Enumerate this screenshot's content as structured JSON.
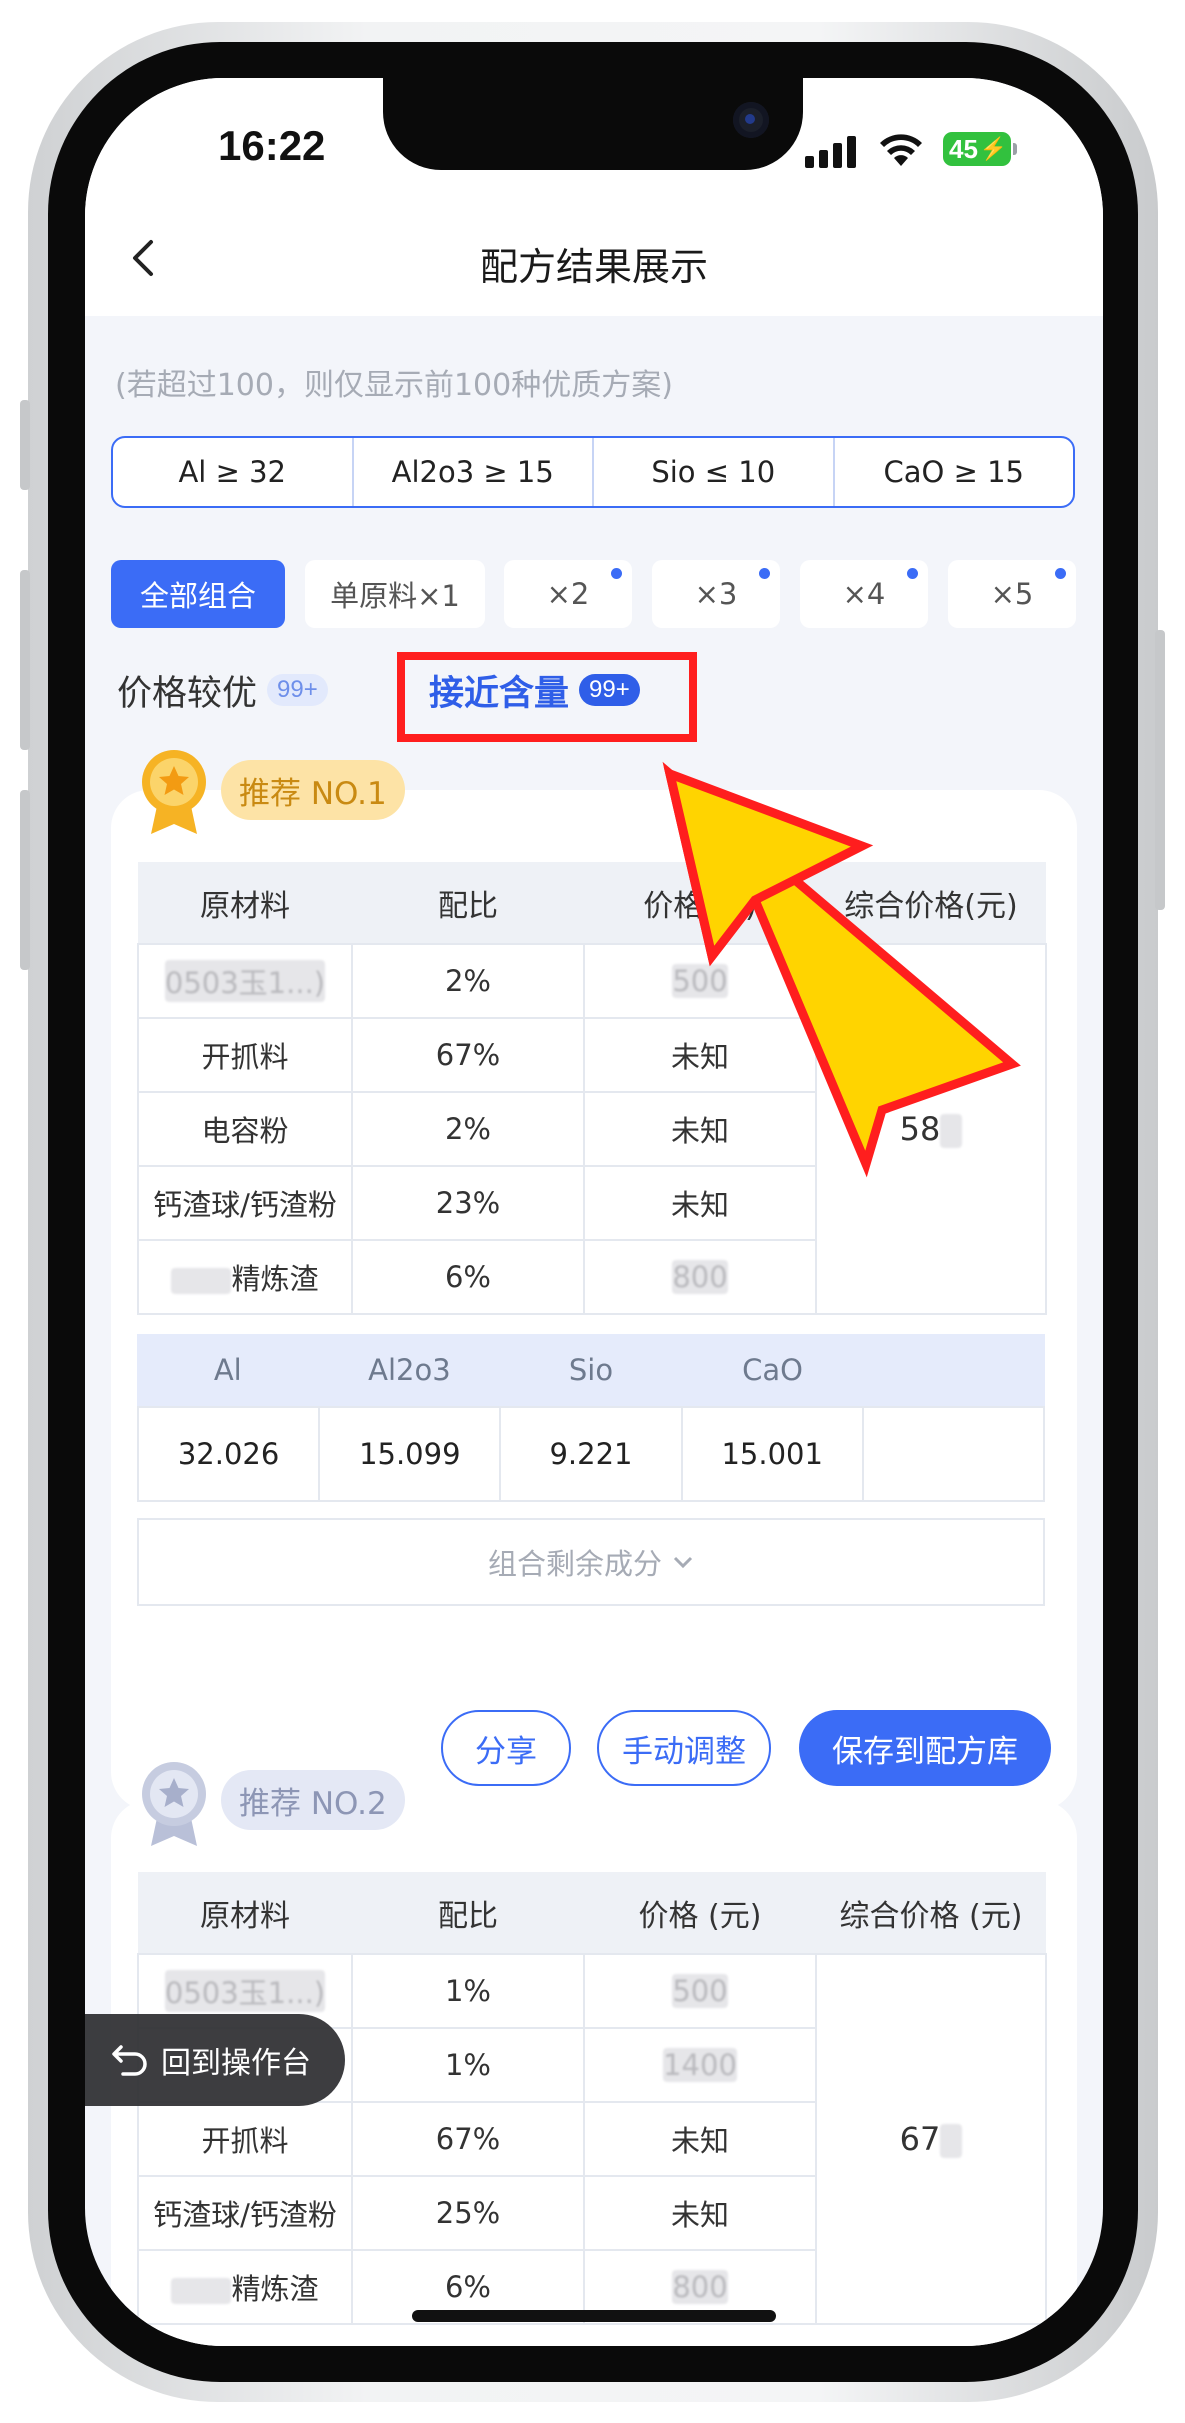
{
  "status": {
    "time": "16:22",
    "battery": "45"
  },
  "nav": {
    "title": "配方结果展示"
  },
  "hint": "(若超过100，则仅显示前100种优质方案)",
  "conditions": [
    "Al ≥ 32",
    "Al2o3 ≥ 15",
    "Sio ≤ 10",
    "CaO ≥ 15"
  ],
  "filters": [
    "全部组合",
    "单原料×1",
    "×2",
    "×3",
    "×4",
    "×5"
  ],
  "sort": {
    "price_label": "价格较优",
    "price_badge": "99+",
    "content_label": "接近含量",
    "content_badge": "99+"
  },
  "card1": {
    "rank": "推荐 NO.1",
    "headers": [
      "原材料",
      "配比",
      "价格(元)",
      "综合价格(元)"
    ],
    "rows": [
      {
        "material": "0503玉1...)",
        "ratio": "2%",
        "price": "500"
      },
      {
        "material": "开抓料",
        "ratio": "67%",
        "price": "未知"
      },
      {
        "material": "电容粉",
        "ratio": "2%",
        "price": "未知"
      },
      {
        "material": "钙渣球/钙渣粉",
        "ratio": "23%",
        "price": "未知"
      },
      {
        "material": "精炼渣",
        "ratio": "6%",
        "price": "800"
      }
    ],
    "total": "58",
    "comp_headers": [
      "Al",
      "Al2o3",
      "Sio",
      "CaO"
    ],
    "comp_values": [
      "32.026",
      "15.099",
      "9.221",
      "15.001"
    ],
    "rest_label": "组合剩余成分",
    "buttons": {
      "share": "分享",
      "adjust": "手动调整",
      "save": "保存到配方库"
    }
  },
  "card2": {
    "rank": "推荐 NO.2",
    "headers": [
      "原材料",
      "配比",
      "价格 (元)",
      "综合价格 (元)"
    ],
    "rows": [
      {
        "material": "0503玉1...)",
        "ratio": "1%",
        "price": "500"
      },
      {
        "material": "",
        "ratio": "1%",
        "price": "1400"
      },
      {
        "material": "开抓料",
        "ratio": "67%",
        "price": "未知"
      },
      {
        "material": "钙渣球/钙渣粉",
        "ratio": "25%",
        "price": "未知"
      },
      {
        "material": "精炼渣",
        "ratio": "6%",
        "price": "800"
      }
    ],
    "total": "67"
  },
  "float_back": "回到操作台",
  "colors": {
    "accent": "#3b6cf6",
    "highlight_red": "#ff1e1e",
    "arrow_yellow": "#ffd400",
    "gold": "#f6b324"
  }
}
